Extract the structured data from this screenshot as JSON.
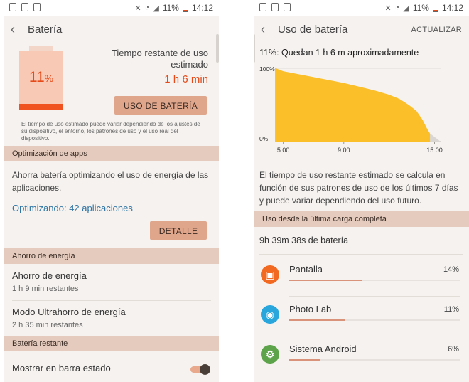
{
  "status": {
    "battery_percent": "11%",
    "time": "14:12"
  },
  "left": {
    "header": {
      "title": "Batería"
    },
    "battery": {
      "percent_number": "11",
      "percent_sign": "%",
      "level": 0.11,
      "remaining_label": "Tiempo restante de uso estimado",
      "remaining_value": "1 h 6 min",
      "usage_button": "USO DE BATERÍA",
      "note": "El tiempo de uso estimado puede variar dependiendo de los ajustes de su dispositivo, el entorno, los patrones de uso y el uso real del dispositivo."
    },
    "optimization": {
      "header": "Optimización de apps",
      "description": "Ahorra batería optimizando el uso de energía de las aplicaciones.",
      "status": "Optimizando: 42 aplicaciones",
      "detail_button": "DETALLE"
    },
    "power_saving": {
      "header": "Ahorro de energía",
      "items": [
        {
          "title": "Ahorro de energía",
          "subtitle": "1 h 9 min restantes"
        },
        {
          "title": "Modo Ultrahorro de energía",
          "subtitle": "2 h 35 min restantes"
        }
      ]
    },
    "remaining": {
      "header": "Batería restante",
      "toggle_label": "Mostrar en barra estado",
      "toggle_on": true
    }
  },
  "right": {
    "header": {
      "title": "Uso de batería",
      "action": "ACTUALIZAR"
    },
    "summary": "11%: Quedan 1 h 6 m aproximadamente",
    "description": "El tiempo de uso restante estimado se calcula en función de sus patrones de uso de los últimos 7 días y puede variar dependiendo del uso futuro.",
    "since_header": "Uso desde la última carga completa",
    "since_value": "9h 39m 38s de batería",
    "apps": [
      {
        "name": "Pantalla",
        "percent": "14%",
        "share": 0.43,
        "icon": "screen-icon",
        "color": "#f26a21"
      },
      {
        "name": "Photo Lab",
        "percent": "11%",
        "share": 0.33,
        "icon": "photo-lab-icon",
        "color": "#29a7dd"
      },
      {
        "name": "Sistema Android",
        "percent": "6%",
        "share": 0.18,
        "icon": "android-system-icon",
        "color": "#5da34a"
      }
    ]
  },
  "chart_data": {
    "type": "area",
    "y_tick_labels": [
      "100%",
      "0%"
    ],
    "x_tick_labels": [
      "5:00",
      "9:00",
      "15:00"
    ],
    "ylim": [
      0,
      100
    ],
    "x_hours": [
      4.5,
      5.0,
      6.0,
      7.0,
      8.0,
      9.0,
      10.0,
      11.0,
      12.0,
      12.7,
      13.3,
      13.8,
      14.2,
      14.5,
      14.7
    ],
    "values": [
      100,
      96,
      92,
      88,
      84,
      80,
      75,
      70,
      64,
      58,
      50,
      42,
      30,
      18,
      11
    ],
    "projection": {
      "x_hours": [
        14.7,
        15.4
      ],
      "values": [
        11,
        0
      ]
    },
    "series_color": "#fbbf2a"
  }
}
